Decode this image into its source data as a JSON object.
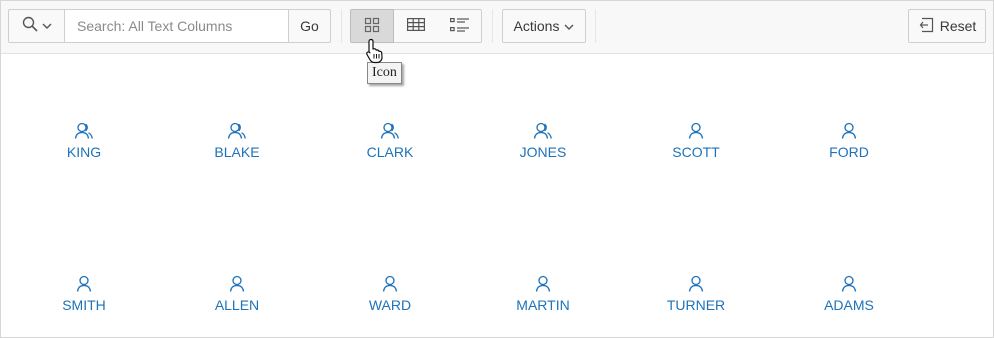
{
  "toolbar": {
    "search_menu_icon": "search-icon",
    "search_placeholder": "Search: All Text Columns",
    "go_label": "Go",
    "views": [
      {
        "name": "icon-view",
        "icon": "grid-icon",
        "selected": true
      },
      {
        "name": "report-view",
        "icon": "table-icon",
        "selected": false
      },
      {
        "name": "detail-view",
        "icon": "list-icon",
        "selected": false
      }
    ],
    "actions_label": "Actions",
    "reset_label": "Reset"
  },
  "tooltip": {
    "text": "Icon"
  },
  "cards": [
    {
      "name": "KING",
      "icon": "users-icon"
    },
    {
      "name": "BLAKE",
      "icon": "users-icon"
    },
    {
      "name": "CLARK",
      "icon": "users-icon"
    },
    {
      "name": "JONES",
      "icon": "users-icon"
    },
    {
      "name": "SCOTT",
      "icon": "user-icon"
    },
    {
      "name": "FORD",
      "icon": "user-icon"
    },
    {
      "name": "SMITH",
      "icon": "user-icon"
    },
    {
      "name": "ALLEN",
      "icon": "user-icon"
    },
    {
      "name": "WARD",
      "icon": "user-icon"
    },
    {
      "name": "MARTIN",
      "icon": "user-icon"
    },
    {
      "name": "TURNER",
      "icon": "user-icon"
    },
    {
      "name": "ADAMS",
      "icon": "user-icon"
    }
  ],
  "colors": {
    "link": "#1e72b9",
    "toolbar_bg": "#f8f8f8",
    "selected_view_bg": "#d9d9d9"
  }
}
